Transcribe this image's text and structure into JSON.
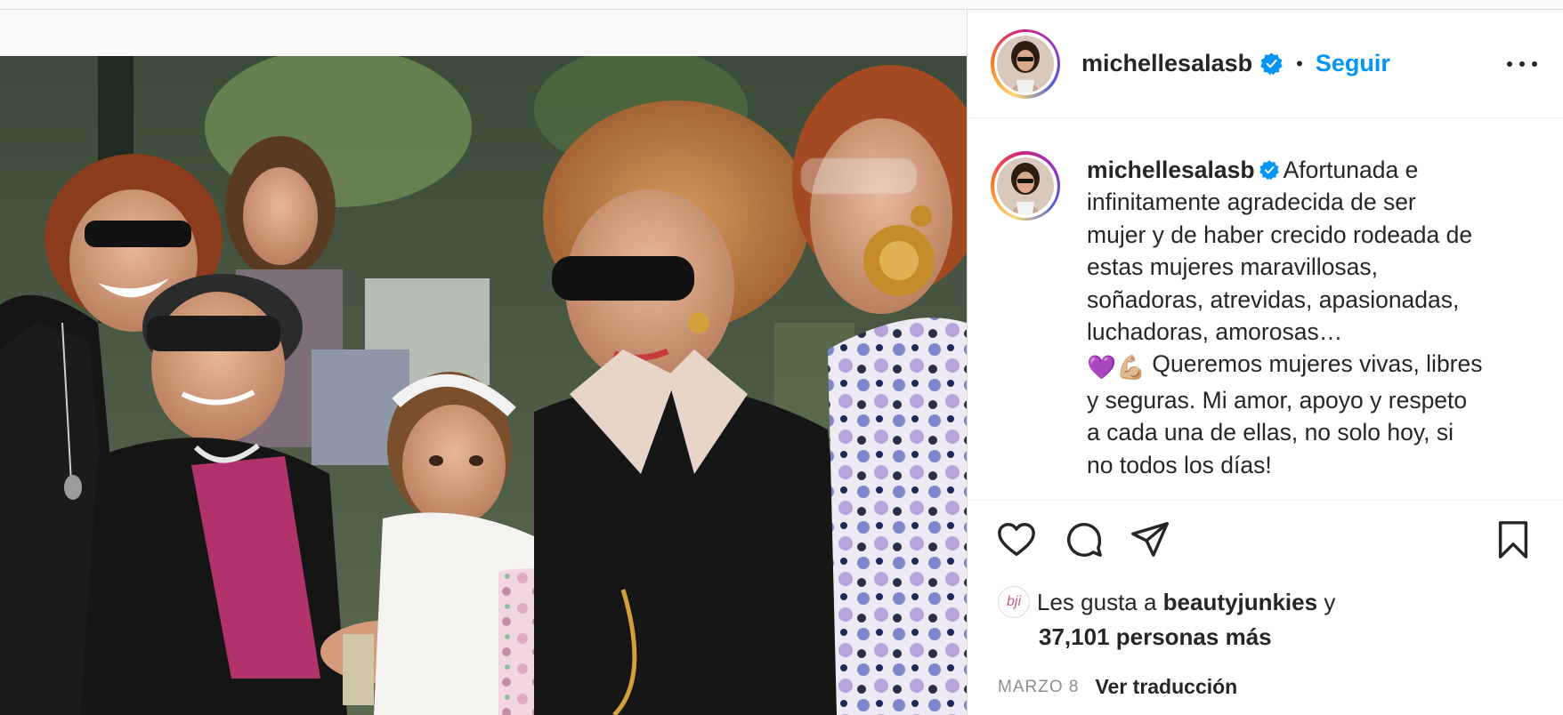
{
  "post": {
    "username": "michellesalasb",
    "follow_label": "Seguir",
    "separator": "•",
    "caption": {
      "line1": "Afortunada e",
      "line2": "infinitamente agradecida de ser",
      "line3": "mujer y de haber crecido rodeada de",
      "line4": "estas mujeres maravillosas,",
      "line5": "soñadoras, atrevidas, apasionadas,",
      "line6": "luchadoras, amorosas…",
      "emoji": "💜💪🏼",
      "line7": "Queremos mujeres vivas, libres",
      "line8": "y seguras. Mi amor, apoyo y respeto",
      "line9": "a cada una de ellas, no solo hoy, si",
      "line10": "no todos los días!"
    },
    "likes": {
      "prefix": "Les gusta a",
      "liker": "beautyjunkies",
      "conj": "y",
      "others": "37,101 personas más",
      "liker_avatar_text": "bji"
    },
    "date": "MARZO 8",
    "translate_label": "Ver traducción"
  },
  "icons": {
    "like": "heart-icon",
    "comment": "comment-icon",
    "share": "paper-plane-icon",
    "save": "bookmark-icon",
    "more": "more-options-icon",
    "verified": "verified-badge-icon"
  },
  "colors": {
    "accent": "#0095f6",
    "text": "#262626",
    "muted": "#8e8e8e",
    "border": "#dbdbdb"
  }
}
